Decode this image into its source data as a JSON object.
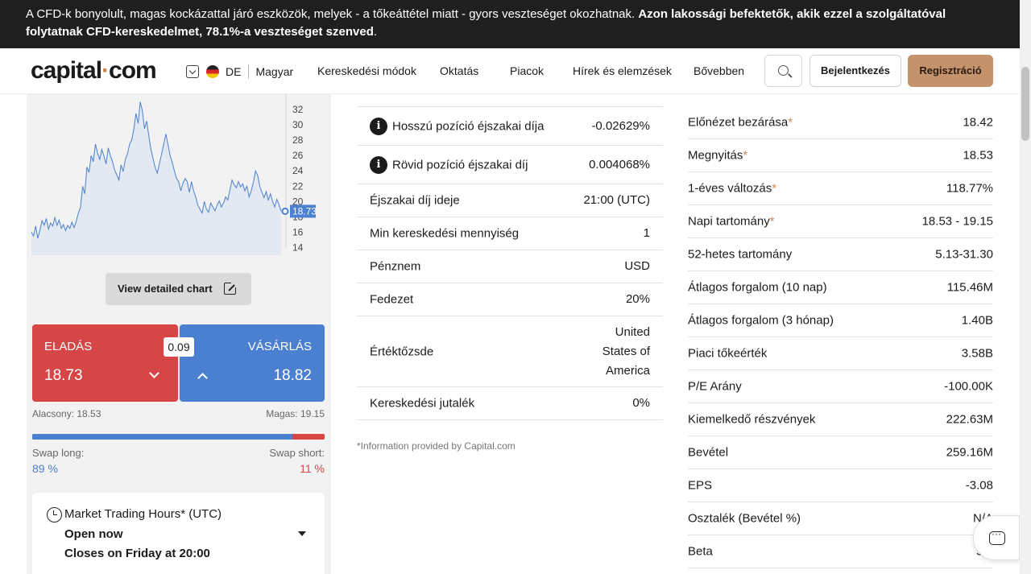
{
  "banner": {
    "text": "A CFD-k bonyolult, magas kockázattal járó eszközök, melyek - a tőkeáttétel miatt - gyors veszteséget okozhatnak.",
    "bold": "Azon lakossági befektetők, akik ezzel a szolgáltatóval folytatnak CFD-kereskedelmet, 78.1%-a veszteséget szenved",
    "tail": "."
  },
  "header": {
    "logo_main": "capital",
    "logo_dot": "·",
    "logo_end": "com",
    "lang_code": "DE",
    "language": "Magyar",
    "nav": [
      "Kereskedési módok",
      "Oktatás",
      "Piacok",
      "Hírek és elemzések",
      "Bővebben"
    ],
    "login": "Bejelentkezés",
    "register": "Regisztráció"
  },
  "chart_data": {
    "type": "line",
    "y_ticks": [
      "32",
      "30",
      "28",
      "26",
      "24",
      "22",
      "20",
      "18",
      "16",
      "14"
    ],
    "ylim": [
      13,
      34
    ],
    "current_value": "18.73",
    "current_marker": 18.73,
    "values": [
      16.0,
      15.5,
      16.8,
      15.2,
      16.3,
      17.5,
      16.9,
      17.8,
      16.4,
      17.2,
      16.8,
      17.9,
      16.9,
      17.6,
      16.5,
      17.0,
      16.2,
      16.9,
      16.5,
      17.3,
      16.6,
      17.4,
      18.5,
      19.2,
      22.0,
      21.0,
      24.5,
      23.8,
      26.0,
      25.2,
      27.5,
      26.3,
      25.5,
      26.8,
      25.9,
      24.9,
      27.0,
      26.0,
      25.2,
      24.1,
      23.5,
      22.8,
      24.8,
      23.9,
      25.5,
      26.2,
      27.5,
      28.0,
      29.5,
      31.5,
      30.2,
      33.0,
      31.8,
      29.5,
      30.5,
      28.6,
      26.8,
      25.6,
      24.4,
      23.7,
      25.0,
      26.2,
      27.5,
      28.8,
      27.4,
      26.0,
      25.1,
      24.0,
      23.0,
      22.6,
      21.4,
      22.4,
      23.0,
      22.6,
      21.2,
      22.6,
      21.4,
      20.6,
      19.5,
      19.0,
      18.5,
      20.0,
      19.0,
      18.6,
      19.8,
      19.3,
      18.8,
      19.5,
      20.1,
      19.3,
      19.8,
      20.6,
      20.2,
      21.5,
      22.8,
      22.2,
      21.8,
      22.6,
      21.9,
      22.3,
      21.4,
      22.0,
      20.6,
      21.4,
      22.5,
      24.0,
      23.4,
      22.0,
      21.2,
      20.5,
      21.3,
      20.2,
      21.0,
      20.0,
      19.3,
      20.3,
      19.6,
      18.73
    ]
  },
  "chart_button": "View detailed chart",
  "trade": {
    "sell_label": "ELADÁS",
    "sell_price": "18.73",
    "buy_label": "VÁSÁRLÁS",
    "buy_price": "18.82",
    "spread": "0.09",
    "low": "Alacsony: 18.53",
    "high": "Magas: 19.15",
    "swap_long_label": "Swap long:",
    "swap_long": "89 %",
    "swap_short_label": "Swap short:",
    "swap_short": "11 %",
    "swap_long_fraction": 0.89
  },
  "hours": {
    "title": "Market Trading Hours* (UTC)",
    "status": "Open now",
    "closes": "Closes on Friday at 20:00"
  },
  "middle": {
    "rows": [
      {
        "label": "Hosszú pozíció éjszakai díja",
        "value": "-0.02629%"
      },
      {
        "label": "Rövid pozíció éjszakai díj",
        "value": "0.004068%"
      },
      {
        "label": "Éjszakai díj ideje",
        "value": "21:00 (UTC)"
      },
      {
        "label": "Min kereskedési mennyiség",
        "value": "1"
      },
      {
        "label": "Pénznem",
        "value": "USD"
      },
      {
        "label": "Fedezet",
        "value": "20%"
      },
      {
        "label": "Értéktőzsde",
        "value": "United States of America"
      },
      {
        "label": "Kereskedési jutalék",
        "value": "0%"
      }
    ],
    "footnote": "*Information provided by Capital.com"
  },
  "right": {
    "rows": [
      {
        "label": "Előnézet bezárása",
        "star": "*",
        "value": "18.42"
      },
      {
        "label": "Megnyitás",
        "star": "*",
        "value": "18.53"
      },
      {
        "label": "1-éves változás",
        "star": "*",
        "value": "118.77%"
      },
      {
        "label": "Napi tartomány",
        "star": "*",
        "value": "18.53 - 19.15"
      },
      {
        "label": "52-hetes tartomány",
        "star": "",
        "value": "5.13-31.30"
      },
      {
        "label": "Átlagos forgalom (10 nap)",
        "star": "",
        "value": "115.46M"
      },
      {
        "label": "Átlagos forgalom (3 hónap)",
        "star": "",
        "value": "1.40B"
      },
      {
        "label": "Piaci tőkeérték",
        "star": "",
        "value": "3.58B"
      },
      {
        "label": "P/E Arány",
        "star": "",
        "value": "-100.00K"
      },
      {
        "label": "Kiemelkedő részvények",
        "star": "",
        "value": "222.63M"
      },
      {
        "label": "Bevétel",
        "star": "",
        "value": "259.16M"
      },
      {
        "label": "EPS",
        "star": "",
        "value": "-3.08"
      },
      {
        "label": "Osztalék (Bevétel %)",
        "star": "",
        "value": "N/A"
      },
      {
        "label": "Beta",
        "star": "",
        "value": "5.2"
      }
    ]
  },
  "colors": {
    "sell": "#d64646",
    "buy": "#4b7fcf",
    "brand": "#c4926b"
  },
  "icons": [
    "search-icon",
    "chevron-down-icon",
    "external-link-icon",
    "clock-icon",
    "info-icon",
    "chat-icon"
  ]
}
